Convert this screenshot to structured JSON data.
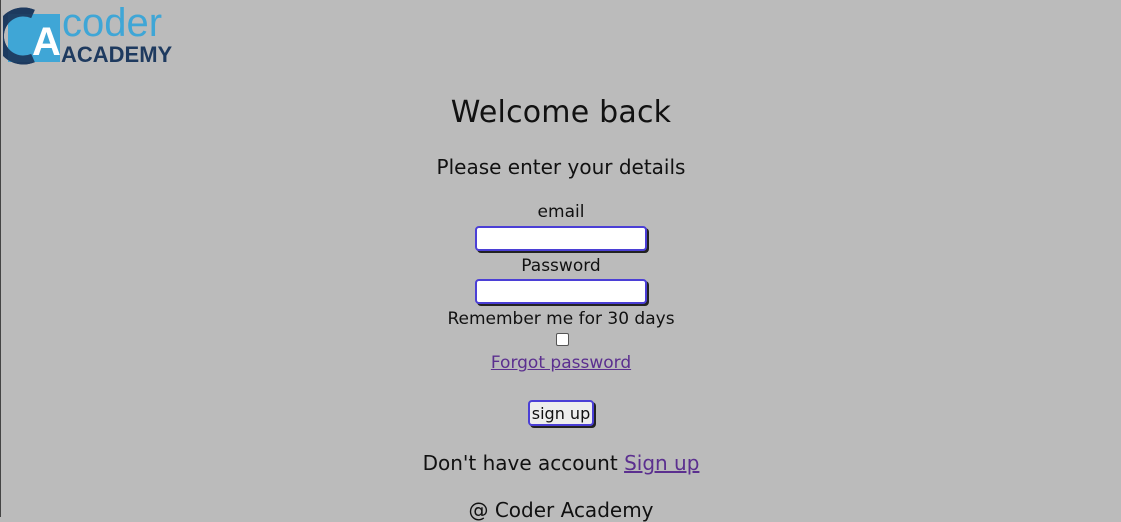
{
  "brand": {
    "logo_word_top": "coder",
    "logo_word_bottom": "ACADEMY",
    "logo_letter": "A",
    "colors": {
      "logo_light_blue": "#3fa6d6",
      "logo_dark_navy": "#1e3a5f",
      "input_border": "#4b3fd6",
      "link": "#5b2f8f",
      "background": "#bbbbbb"
    }
  },
  "login": {
    "title": "Welcome back",
    "subtitle": "Please enter your details",
    "email_label": "email",
    "email_value": "",
    "password_label": "Password",
    "password_value": "",
    "remember_label": "Remember me for 30 days",
    "remember_checked": false,
    "forgot_link": "Forgot password",
    "submit_label": "sign up",
    "no_account_text": "Don't have account",
    "signup_link": "Sign up"
  },
  "footer": {
    "text": "@ Coder Academy"
  }
}
